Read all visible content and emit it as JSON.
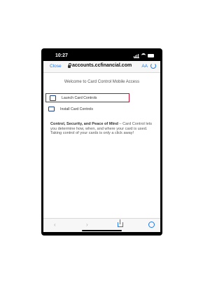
{
  "status_bar": {
    "time": "10:27"
  },
  "browser": {
    "close_label": "Close",
    "url": "accounts.ccfinancial.com",
    "text_size_label": "AA"
  },
  "page": {
    "welcome": "Welcome to Card Control Mobile Access",
    "launch_label": "Launch Card Controls",
    "install_label": "Install Card Controls",
    "desc_bold": "Control, Security, and Peace of Mind",
    "desc_rest": " – Card Control lets you determine how, when, and where your card is used. Taking control of your cards is only a click away!"
  },
  "toolbar": {
    "back_glyph": "‹",
    "forward_glyph": "›"
  },
  "icons": {
    "launch": "external-link-icon",
    "install": "mail-icon",
    "lock": "lock-icon",
    "reload": "reload-icon",
    "share": "share-icon",
    "compass": "compass-icon"
  },
  "colors": {
    "accent": "#1d7af3",
    "highlight": "#c8102e"
  }
}
